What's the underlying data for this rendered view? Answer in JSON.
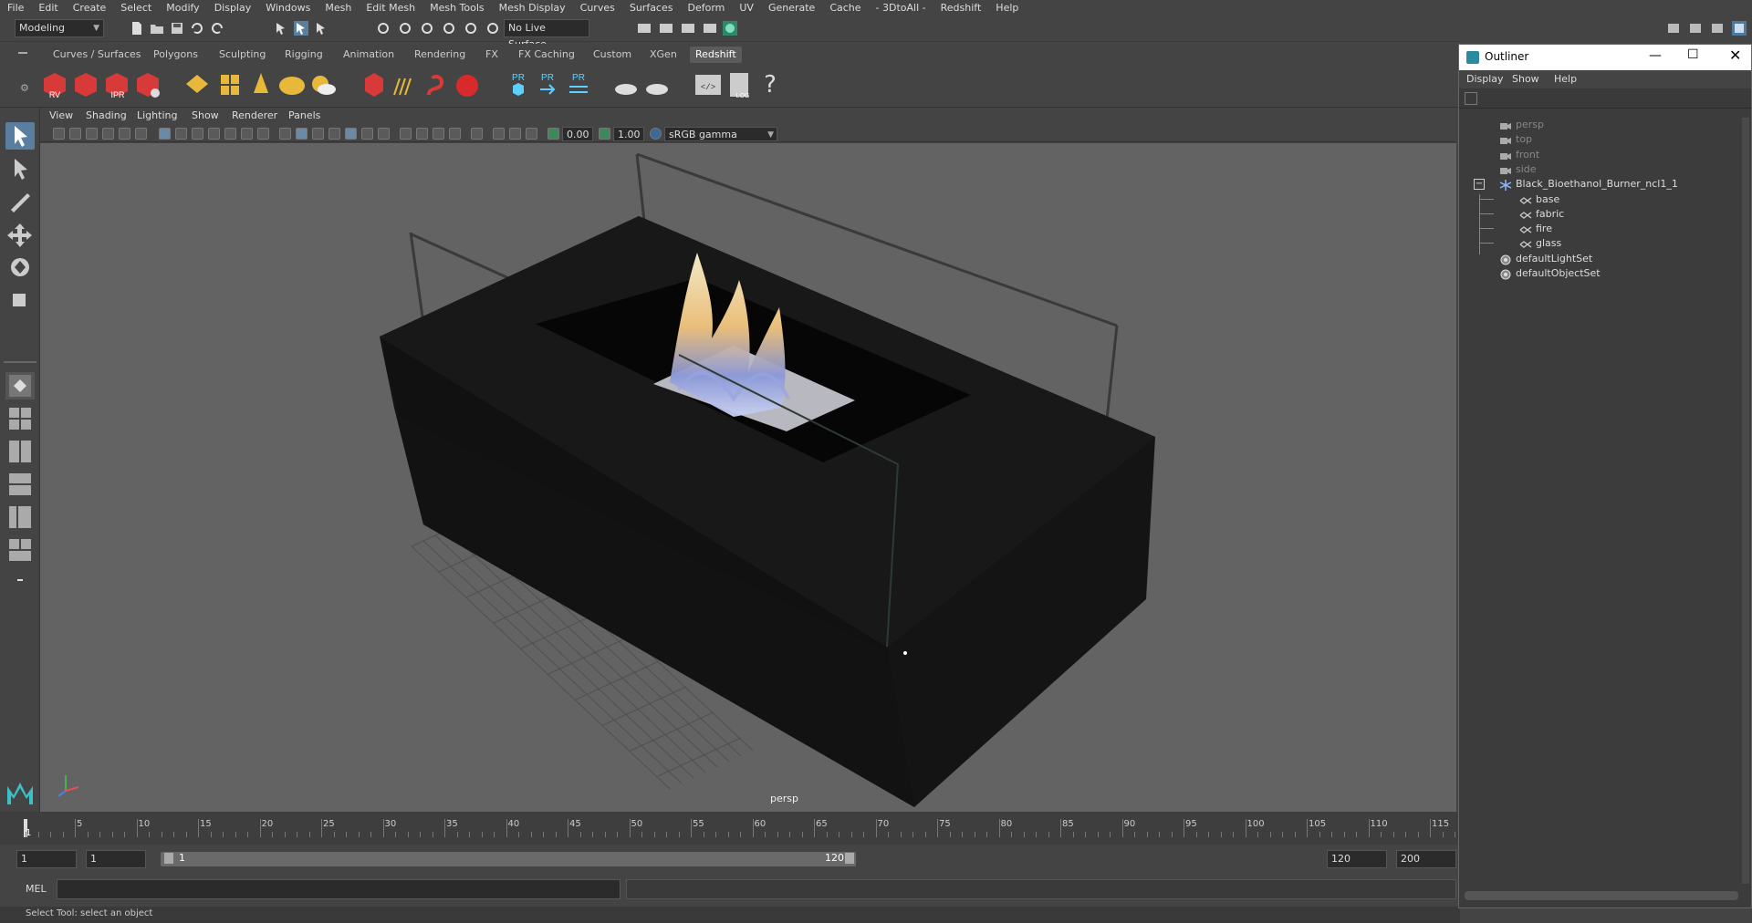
{
  "menubar": [
    "File",
    "Edit",
    "Create",
    "Select",
    "Modify",
    "Display",
    "Windows",
    "Mesh",
    "Edit Mesh",
    "Mesh Tools",
    "Mesh Display",
    "Curves",
    "Surfaces",
    "Deform",
    "UV",
    "Generate",
    "Cache",
    "- 3DtoAll -",
    "Redshift",
    "Help"
  ],
  "statusline": {
    "mode": "Modeling",
    "live_surface": "No Live Surface"
  },
  "shelf_tabs": [
    "Curves / Surfaces",
    "Polygons",
    "Sculpting",
    "Rigging",
    "Animation",
    "Rendering",
    "FX",
    "FX Caching",
    "Custom",
    "XGen",
    "Redshift"
  ],
  "shelf_active": "Redshift",
  "shelf_labels": {
    "rv": "RV",
    "ipr": "IPR",
    "pr1": "PR",
    "pr2": "PR",
    "pr3": "PR",
    "log": "LOG"
  },
  "viewport_menu": [
    "View",
    "Shading",
    "Lighting",
    "Show",
    "Renderer",
    "Panels"
  ],
  "viewport_fields": {
    "exposure": "0.00",
    "gamma": "1.00",
    "colorspace": "sRGB gamma"
  },
  "camera_label": "persp",
  "timeline": {
    "ticks": [
      "5",
      "10",
      "15",
      "20",
      "25",
      "30",
      "35",
      "40",
      "45",
      "50",
      "55",
      "60",
      "65",
      "70",
      "75",
      "80",
      "85",
      "90",
      "95",
      "100",
      "105",
      "110",
      "115"
    ],
    "current": "1"
  },
  "range": {
    "start": "1",
    "current": "1",
    "range_start": "1",
    "range_end": "120",
    "end": "120",
    "max": "200"
  },
  "cmdline": {
    "label": "MEL"
  },
  "helpline": "Select Tool: select an object",
  "outliner": {
    "title": "Outliner",
    "menu": [
      "Display",
      "Show",
      "Help"
    ],
    "items": [
      {
        "label": "persp",
        "depth": 0,
        "dim": true,
        "icon": "camera-icon"
      },
      {
        "label": "top",
        "depth": 0,
        "dim": true,
        "icon": "camera-icon"
      },
      {
        "label": "front",
        "depth": 0,
        "dim": true,
        "icon": "camera-icon"
      },
      {
        "label": "side",
        "depth": 0,
        "dim": true,
        "icon": "camera-icon"
      },
      {
        "label": "Black_Bioethanol_Burner_ncl1_1",
        "depth": 0,
        "dim": false,
        "icon": "group-icon"
      },
      {
        "label": "base",
        "depth": 1,
        "dim": false,
        "icon": "mesh-icon"
      },
      {
        "label": "fabric",
        "depth": 1,
        "dim": false,
        "icon": "mesh-icon"
      },
      {
        "label": "fire",
        "depth": 1,
        "dim": false,
        "icon": "mesh-icon"
      },
      {
        "label": "glass",
        "depth": 1,
        "dim": false,
        "icon": "mesh-icon"
      },
      {
        "label": "defaultLightSet",
        "depth": 0,
        "dim": false,
        "icon": "set-icon"
      },
      {
        "label": "defaultObjectSet",
        "depth": 0,
        "dim": false,
        "icon": "set-icon"
      }
    ]
  },
  "colors": {
    "accent": "#5dd0ff",
    "shelf_red": "#d83a3a",
    "shelf_yellow": "#e8b83a",
    "selected_green": "#4caf50"
  }
}
